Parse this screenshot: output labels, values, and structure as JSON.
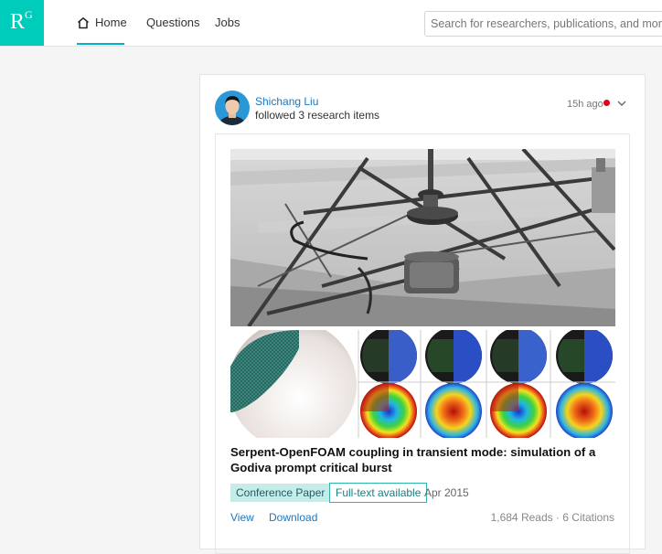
{
  "logo": {
    "letter": "R",
    "superscript": "G"
  },
  "nav": {
    "home": "Home",
    "questions": "Questions",
    "jobs": "Jobs"
  },
  "search": {
    "placeholder": "Search for researchers, publications, and more"
  },
  "feed": {
    "author": "Shichang Liu",
    "action": "followed 3 research items",
    "time": "15h ago",
    "colors": {
      "unread_dot": "#e1001a",
      "accent": "#00ccbb",
      "link": "#1a78c2"
    },
    "publication": {
      "title": "Serpent-OpenFOAM coupling in transient mode: simulation of a Godiva prompt critical burst",
      "type": "Conference Paper",
      "fulltext": "Full-text available",
      "date": "Apr 2015",
      "stats": "1,684 Reads · 6 Citations",
      "view": "View",
      "download": "Download"
    }
  }
}
